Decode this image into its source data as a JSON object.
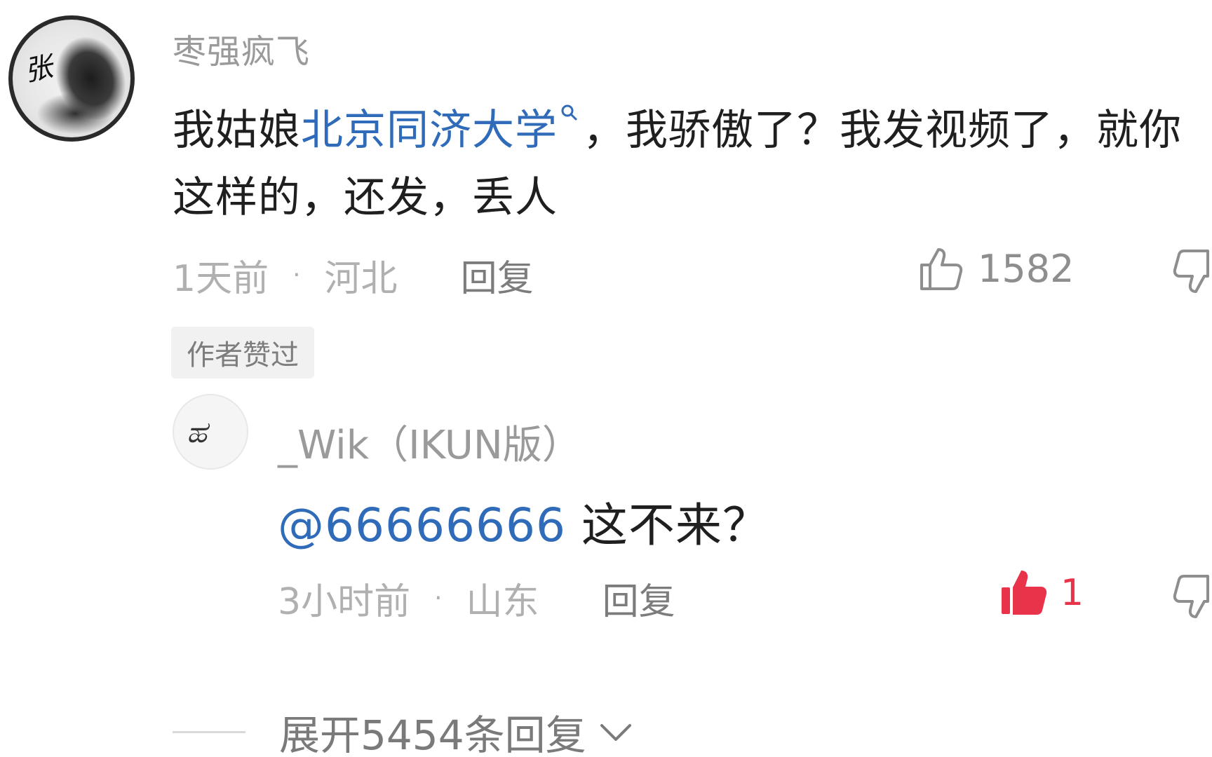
{
  "comment": {
    "username": "枣强疯飞",
    "text_part1": "我姑娘",
    "link_text": "北京同济大学",
    "text_part2": "，我骄傲了？我发视频了，就你这样的，还发，丢人",
    "time": "1天前",
    "location": "河北",
    "reply_label": "回复",
    "like_count": "1582",
    "author_badge": "作者赞过",
    "avatar_text": "张"
  },
  "reply": {
    "username": "_Wik（IKUN版）",
    "mention": "@66666666",
    "text": " 这不来？",
    "time": "3小时前",
    "location": "山东",
    "reply_label": "回复",
    "like_count": "1",
    "like_color": "#e8334a"
  },
  "expand": {
    "label": "展开5454条回复"
  },
  "icons": {
    "like": "thumbs-up-outline-icon",
    "liked": "thumbs-up-filled-icon",
    "dislike": "thumbs-down-outline-icon",
    "expand": "chevron-down-icon",
    "search": "search-icon"
  },
  "colors": {
    "link": "#2f6bb8",
    "meta": "#b0b0b0",
    "text": "#1f1f1f"
  }
}
